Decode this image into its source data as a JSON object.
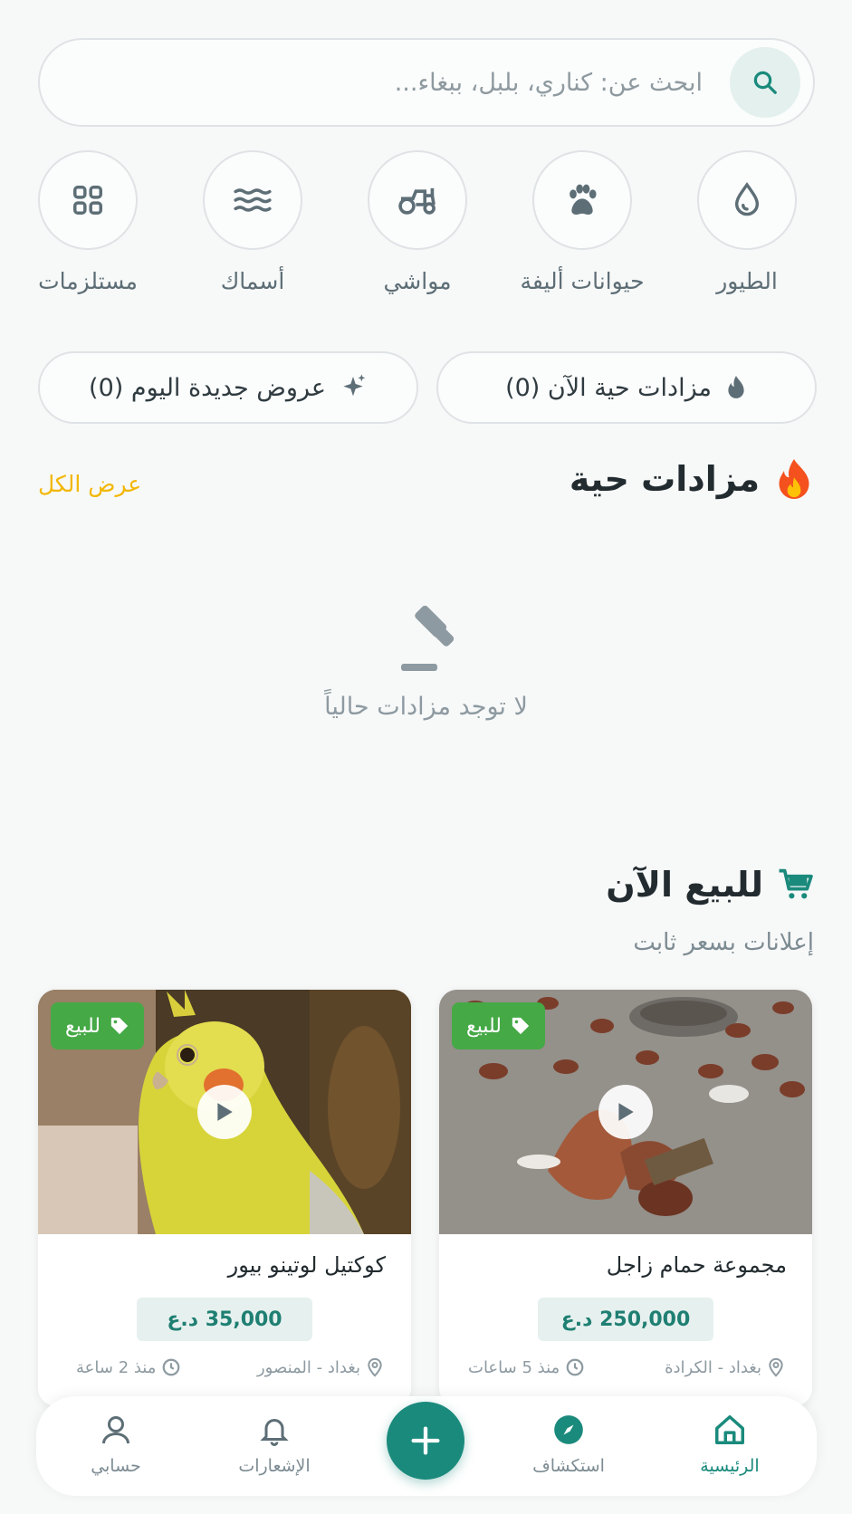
{
  "search": {
    "placeholder": "ابحث عن: كناري، بلبل، ببغاء..."
  },
  "categories": [
    {
      "label": "الطيور",
      "icon": "drop-icon"
    },
    {
      "label": "حيوانات أليفة",
      "icon": "paw-icon"
    },
    {
      "label": "مواشي",
      "icon": "tractor-icon"
    },
    {
      "label": "أسماك",
      "icon": "waves-icon"
    },
    {
      "label": "مستلزمات",
      "icon": "grid-icon"
    }
  ],
  "pills": {
    "live_label": "مزادات حية الآن (0)",
    "new_label": "عروض جديدة اليوم (0)"
  },
  "live_section": {
    "title": "مزادات حية",
    "see_all": "عرض الكل",
    "empty_text": "لا توجد مزادات حالياً"
  },
  "sale_section": {
    "title": "للبيع الآن",
    "subtitle": "إعلانات بسعر ثابت"
  },
  "listings": [
    {
      "badge": "للبيع",
      "title": "مجموعة حمام زاجل",
      "price": "250,000 د.ع",
      "location": "بغداد - الكرادة",
      "time": "منذ 5 ساعات"
    },
    {
      "badge": "للبيع",
      "title": "كوكتيل لوتينو بيور",
      "price": "35,000 د.ع",
      "location": "بغداد - المنصور",
      "time": "منذ 2 ساعة"
    }
  ],
  "nav": {
    "home": "الرئيسية",
    "explore": "استكشاف",
    "notifications": "الإشعارات",
    "account": "حسابي"
  },
  "colors": {
    "accent": "#1a8a7c",
    "see_all": "#f2b705",
    "badge": "#45a946"
  }
}
